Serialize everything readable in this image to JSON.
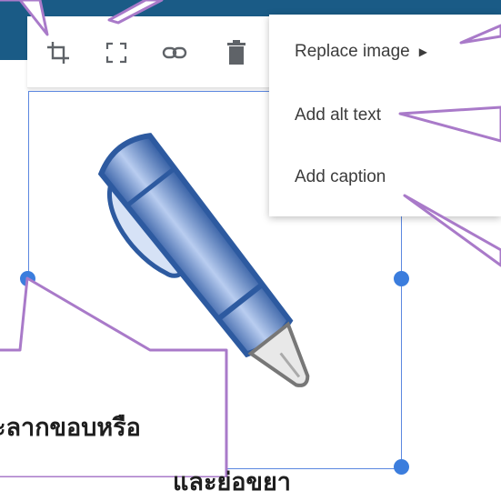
{
  "toolbar": {
    "buttons": [
      {
        "icon": "crop-icon"
      },
      {
        "icon": "fullscreen-icon"
      },
      {
        "icon": "link-icon"
      },
      {
        "icon": "trash-icon"
      }
    ]
  },
  "menu": {
    "items": [
      {
        "label": "Replace image",
        "has_submenu": true
      },
      {
        "label": "Add alt text"
      },
      {
        "label": "Add caption"
      }
    ]
  },
  "callout": {
    "line1": "ะลากขอบหรือ",
    "line2": "และย่อขยา"
  },
  "colors": {
    "header_blue": "#1a5b86",
    "selection_blue": "#3b7ddd",
    "callout_purple": "#a97ac9"
  }
}
